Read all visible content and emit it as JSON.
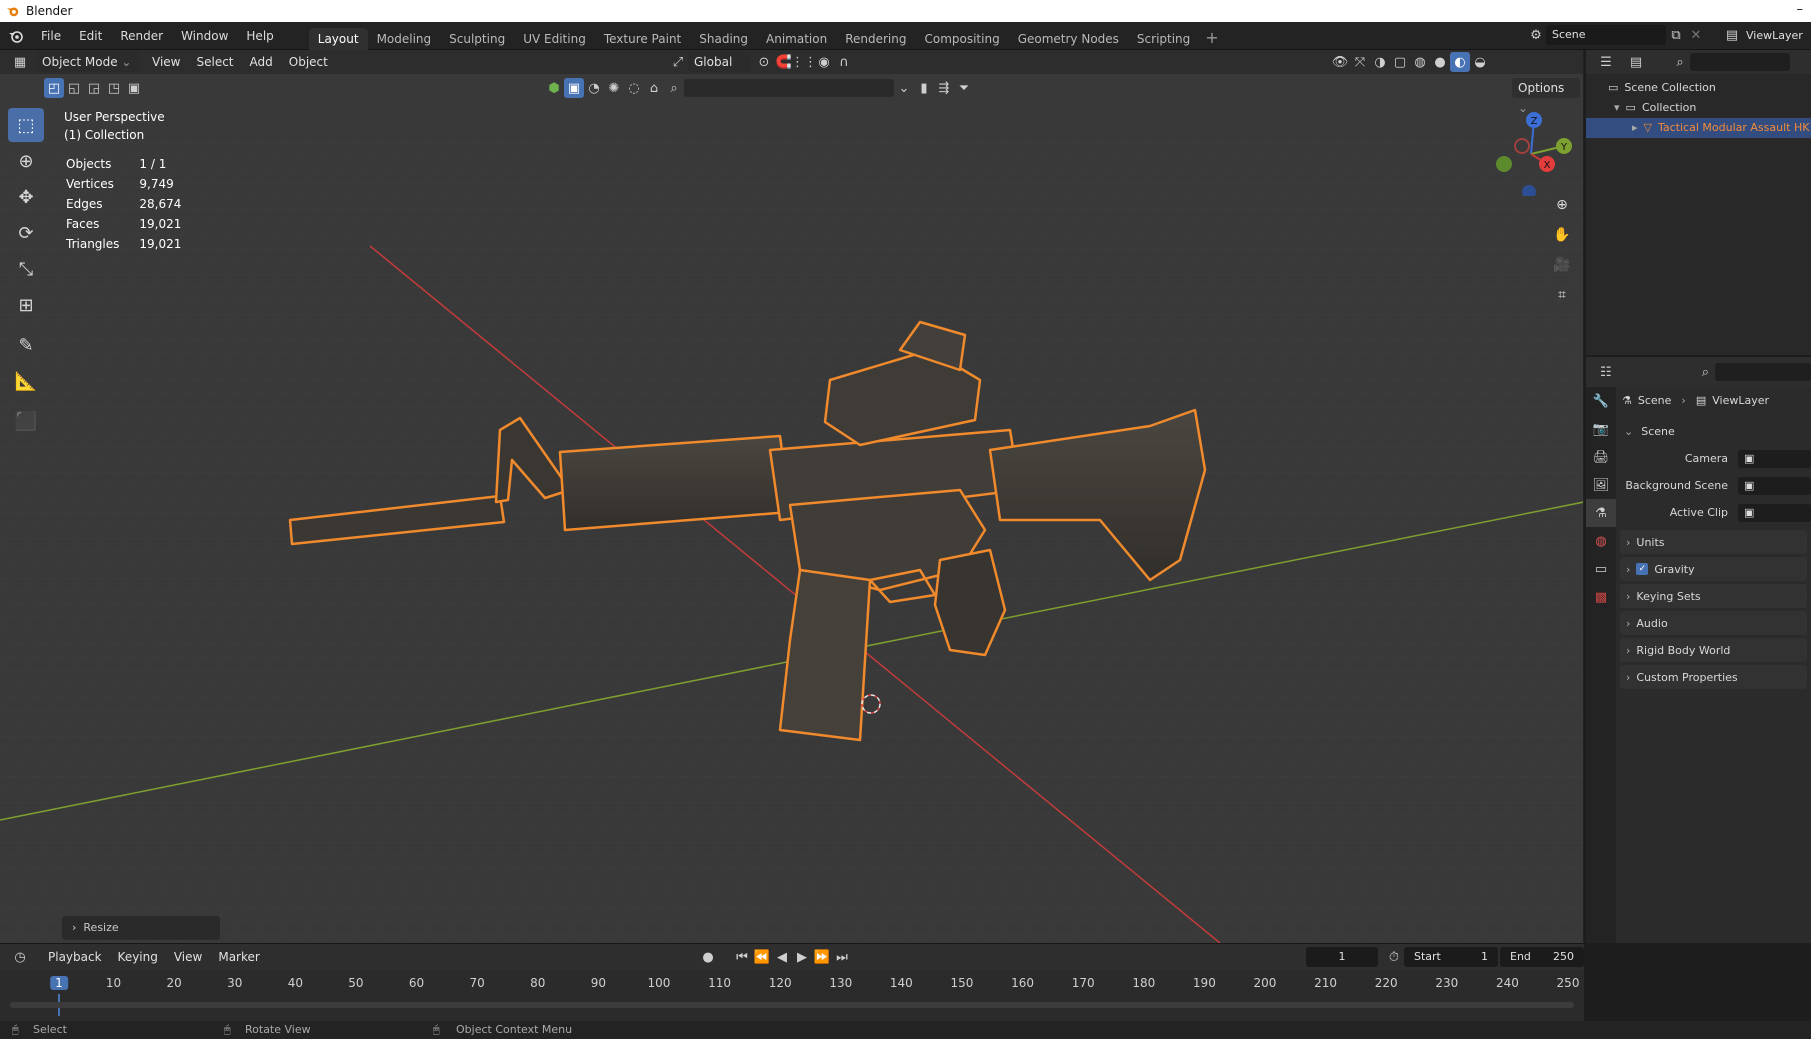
{
  "os_window": {
    "title": "Blender",
    "minimize_glyph": "–"
  },
  "menus": [
    "File",
    "Edit",
    "Render",
    "Window",
    "Help"
  ],
  "workspaces": [
    "Layout",
    "Modeling",
    "Sculpting",
    "UV Editing",
    "Texture Paint",
    "Shading",
    "Animation",
    "Rendering",
    "Compositing",
    "Geometry Nodes",
    "Scripting"
  ],
  "active_workspace": "Layout",
  "top_right": {
    "scene_label": "Scene",
    "viewlayer_label": "ViewLayer"
  },
  "viewport_header": {
    "mode": "Object Mode",
    "menus": [
      "View",
      "Select",
      "Add",
      "Object"
    ],
    "transform_orientation": "Global",
    "options_label": "Options"
  },
  "viewport_overlay": {
    "perspective": "User Perspective",
    "collection": "(1) Collection",
    "stats": [
      {
        "label": "Objects",
        "value": "1 / 1"
      },
      {
        "label": "Vertices",
        "value": "9,749"
      },
      {
        "label": "Edges",
        "value": "28,674"
      },
      {
        "label": "Faces",
        "value": "19,021"
      },
      {
        "label": "Triangles",
        "value": "19,021"
      }
    ]
  },
  "gizmo": {
    "x": "X",
    "y": "Y",
    "z": "Z"
  },
  "resize_panel": {
    "label": "Resize"
  },
  "outliner": {
    "root": "Scene Collection",
    "collection": "Collection",
    "object": "Tactical Modular Assault HK"
  },
  "properties": {
    "breadcrumb_scene": "Scene",
    "breadcrumb_viewlayer": "ViewLayer",
    "section": "Scene",
    "fields": [
      {
        "label": "Camera"
      },
      {
        "label": "Background Scene"
      },
      {
        "label": "Active Clip"
      }
    ],
    "panels": [
      {
        "label": "Units",
        "checkbox": false
      },
      {
        "label": "Gravity",
        "checkbox": true
      },
      {
        "label": "Keying Sets",
        "checkbox": false
      },
      {
        "label": "Audio",
        "checkbox": false
      },
      {
        "label": "Rigid Body World",
        "checkbox": false
      },
      {
        "label": "Custom Properties",
        "checkbox": false
      }
    ]
  },
  "timeline": {
    "menus": [
      "Playback",
      "Keying",
      "View",
      "Marker"
    ],
    "current_frame": "1",
    "start_label": "Start",
    "start_value": "1",
    "end_label": "End",
    "end_value": "250",
    "ruler_ticks": [
      "1",
      "10",
      "20",
      "30",
      "40",
      "50",
      "60",
      "70",
      "80",
      "90",
      "100",
      "110",
      "120",
      "130",
      "140",
      "150",
      "160",
      "170",
      "180",
      "190",
      "200",
      "210",
      "220",
      "230",
      "240",
      "250"
    ]
  },
  "statusbar": {
    "select": "Select",
    "rotate": "Rotate View",
    "context": "Object Context Menu"
  },
  "colors": {
    "accent_blue": "#4772b3",
    "selection_orange": "#f08a2c",
    "axis_red": "#c33b3b",
    "axis_green": "#7da130",
    "viewport_bg": "#393939"
  }
}
